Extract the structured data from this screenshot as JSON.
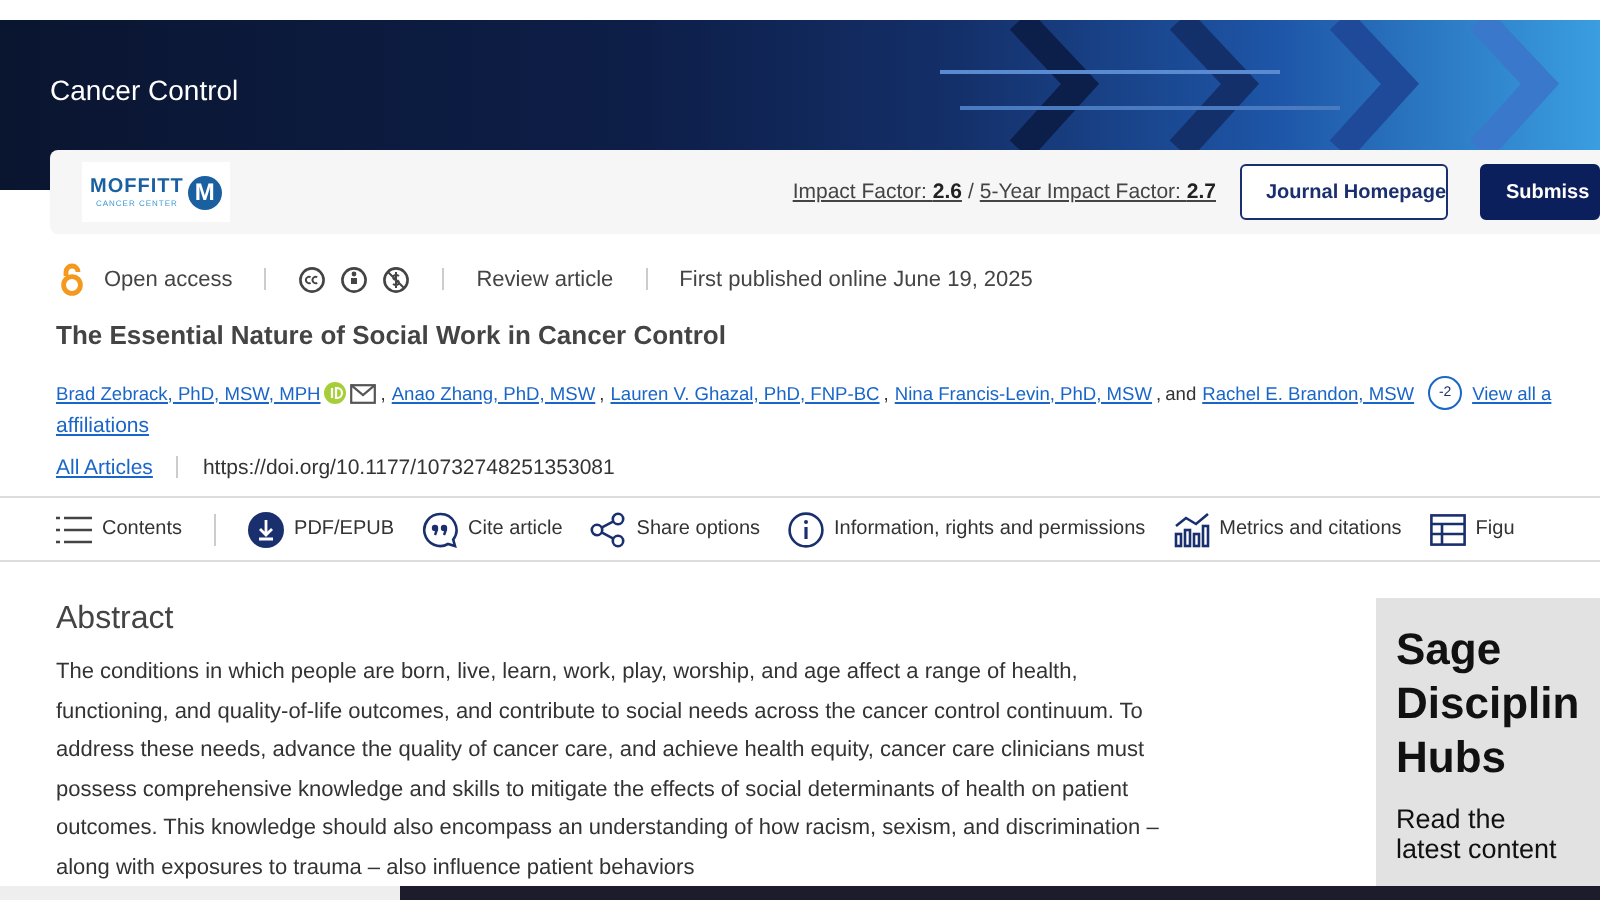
{
  "banner": {
    "journal_title": "Cancer Control"
  },
  "header": {
    "logo": {
      "name": "MOFFITT",
      "subtitle": "CANCER CENTER",
      "letter": "M"
    },
    "impact_links": [
      "Impact Factor: **2.6**",
      "5-Year Impact Factor: **2.7**"
    ],
    "impact_separator": "/",
    "buttons": [
      {
        "label": "Journal Homepage",
        "kind": "outline"
      },
      {
        "label": "Submiss",
        "kind": "filled"
      }
    ]
  },
  "meta": {
    "access": "Open access",
    "article_type": "Review article",
    "published": "First published online June 19, 2025"
  },
  "article": {
    "title": "The Essential Nature of Social Work in Cancer Control",
    "authors": [
      {
        "name": "Brad Zebrack, PhD, MSW, MPH",
        "orcid": true,
        "email": true
      },
      {
        "name": "Anao Zhang, PhD, MSW",
        "orcid": false,
        "email": false
      },
      {
        "name": "Lauren V. Ghazal, PhD, FNP-BC",
        "orcid": false,
        "email": false
      },
      {
        "name": "Nina Francis-Levin, PhD, MSW",
        "orcid": false,
        "email": false
      },
      {
        "name": "Rachel E. Brandon, MSW",
        "orcid": false,
        "email": false
      }
    ],
    "separator": ",",
    "conjunction": "and",
    "more_count": "-2",
    "view_all": "View all a",
    "affiliations": "affiliations",
    "all_articles": "All Articles",
    "doi": "https://doi.org/10.1177/10732748251353081"
  },
  "toolbar": [
    {
      "label": "Contents"
    },
    {
      "label": "PDF/EPUB"
    },
    {
      "label": "Cite article"
    },
    {
      "label": "Share options"
    },
    {
      "label": "Information, rights and permissions"
    },
    {
      "label": "Metrics and citations"
    },
    {
      "label": "Figu"
    }
  ],
  "abstract": {
    "heading": "Abstract",
    "text": "The conditions in which people are born, live, learn, work, play, worship, and age affect a range of health, functioning, and quality-of-life outcomes, and contribute to social needs across the cancer control continuum. To address these needs, advance the quality of cancer care, and achieve health equity, cancer care clinicians must possess comprehensive knowledge and skills to mitigate the effects of social determinants of health on patient outcomes. This knowledge should also encompass an understanding of how racism, sexism, and discrimination – along with exposures to trauma – also influence patient behaviors"
  },
  "sidebar_ad": {
    "heading": [
      "Sage",
      "Disciplin",
      "Hubs"
    ],
    "subtitle": "Read the latest content"
  }
}
